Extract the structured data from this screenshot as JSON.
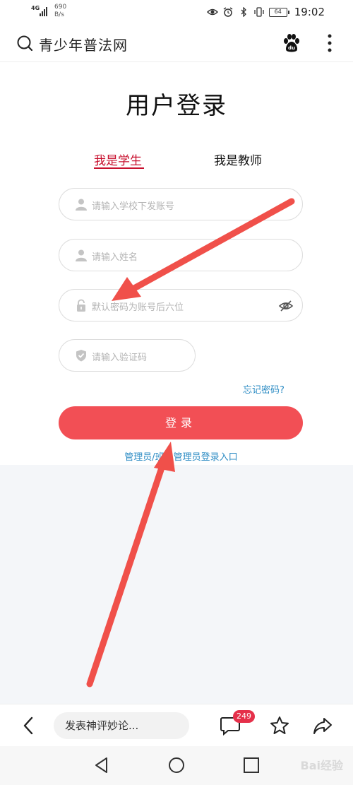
{
  "status_bar": {
    "network": "4G",
    "speed_value": "690",
    "speed_unit": "B/s",
    "battery": "64",
    "time": "19:02"
  },
  "topbar": {
    "title": "青少年普法网",
    "icons": [
      "search-icon",
      "baidu-paw-icon",
      "more-vertical-icon"
    ]
  },
  "login": {
    "title": "用户登录",
    "tabs": [
      {
        "label": "我是学生",
        "active": true
      },
      {
        "label": "我是教师",
        "active": false
      }
    ],
    "fields": {
      "account_placeholder": "请输入学校下发账号",
      "name_placeholder": "请输入姓名",
      "password_placeholder": "默认密码为账号后六位",
      "captcha_placeholder": "请输入验证码"
    },
    "forgot_label": "忘记密码?",
    "submit_label": "登录",
    "admin_link": "管理员/班主管理员登录入口"
  },
  "bottom_bar": {
    "comment_placeholder": "发表神评妙论...",
    "comment_count": "249",
    "icons": [
      "back-icon",
      "comment-icon",
      "star-icon",
      "share-icon"
    ]
  },
  "system_nav": {
    "icons": [
      "back-triangle-icon",
      "home-circle-icon",
      "recents-square-icon"
    ],
    "watermark": "Bai经验"
  },
  "colors": {
    "accent_red": "#c8102e",
    "button_red": "#f24f55",
    "link_blue": "#2d8cc4",
    "arrow_red": "#f0504a"
  }
}
